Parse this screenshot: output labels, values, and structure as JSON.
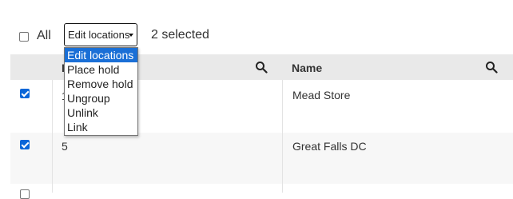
{
  "toolbar": {
    "all_label": "All",
    "bulk_action_select": {
      "value": "Edit locations",
      "options": [
        "Edit locations",
        "Place hold",
        "Remove hold",
        "Ungroup",
        "Unlink",
        "Link"
      ]
    },
    "selected_count": "2 selected"
  },
  "table": {
    "columns": [
      {
        "label": "Id"
      },
      {
        "label": "Name"
      }
    ],
    "rows": [
      {
        "checked": true,
        "id": "1",
        "name": "Mead Store"
      },
      {
        "checked": true,
        "id": "5",
        "name": "Great Falls DC"
      }
    ]
  },
  "colors": {
    "accent": "#0a66d8",
    "header_bg": "#e9e9e9",
    "dropdown_highlight": "#1a6fd6"
  },
  "icons": {
    "column_search": "search-icon",
    "select_arrow": "chevron-down-icon"
  }
}
